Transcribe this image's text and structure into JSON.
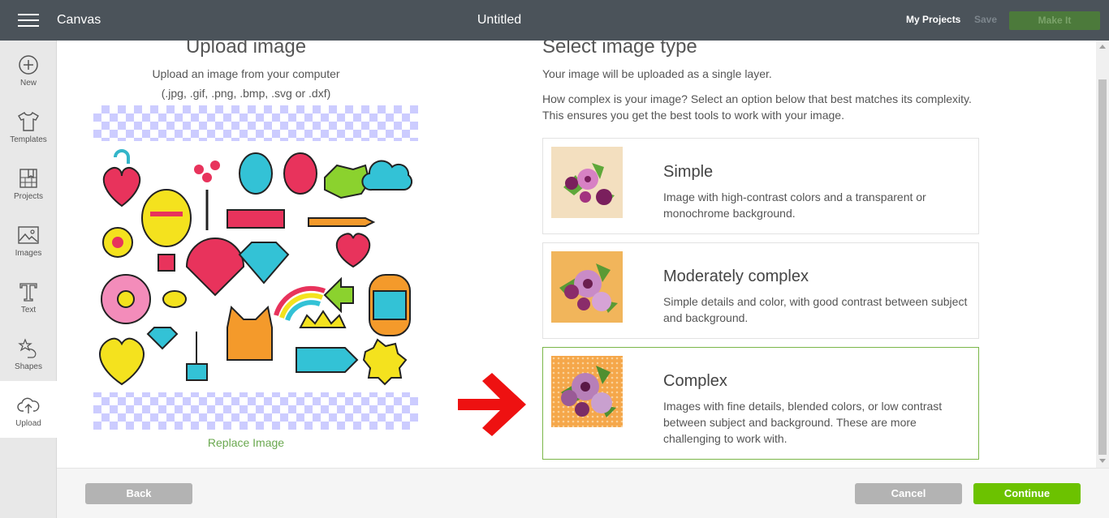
{
  "topbar": {
    "app_name": "Canvas",
    "doc_title": "Untitled",
    "my_projects": "My Projects",
    "save": "Save",
    "make_it": "Make It"
  },
  "sidebar": {
    "items": [
      {
        "label": "New",
        "icon": "plus-circle-icon"
      },
      {
        "label": "Templates",
        "icon": "shirt-icon"
      },
      {
        "label": "Projects",
        "icon": "bookmark-grid-icon"
      },
      {
        "label": "Images",
        "icon": "image-icon"
      },
      {
        "label": "Text",
        "icon": "text-t-icon"
      },
      {
        "label": "Shapes",
        "icon": "shapes-icon"
      },
      {
        "label": "Upload",
        "icon": "cloud-upload-icon"
      }
    ],
    "active": "Upload"
  },
  "upload": {
    "title": "Upload image",
    "subtitle": "Upload an image from your computer",
    "formats": "(.jpg, .gif, .png, .bmp, .svg or .dxf)",
    "replace": "Replace Image"
  },
  "select": {
    "title": "Select image type",
    "subtitle": "Your image will be uploaded as a single layer.",
    "description": "How complex is your image? Select an option below that best matches its complexity. This ensures you get the best tools to work with your image.",
    "options": [
      {
        "title": "Simple",
        "desc": "Image with high-contrast colors and a transparent or monochrome background.",
        "thumb_bg": "#f3dfbf"
      },
      {
        "title": "Moderately complex",
        "desc": "Simple details and color, with good contrast between subject and background.",
        "thumb_bg": "#f1b55b"
      },
      {
        "title": "Complex",
        "desc": "Images with fine details, blended colors, or low contrast between subject and background. These are more challenging to work with.",
        "thumb_bg": "#f5a74a"
      }
    ],
    "selected": "Complex"
  },
  "footer": {
    "back": "Back",
    "cancel": "Cancel",
    "continue": "Continue"
  },
  "colors": {
    "topbar": "#4b535a",
    "accent_green": "#6cc200",
    "selected_border": "#7ab648",
    "arrow_red": "#ee1111"
  }
}
